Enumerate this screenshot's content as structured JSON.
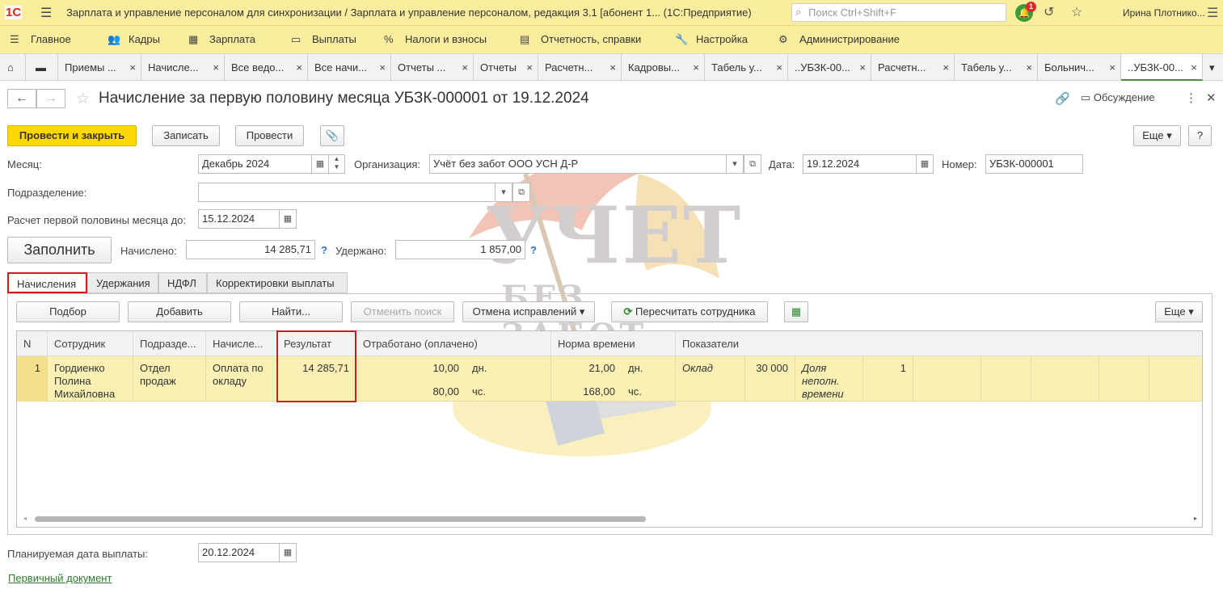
{
  "titlebar": {
    "logo": "1С",
    "title": "Зарплата и управление персоналом для синхронизации / Зарплата и управление персоналом, редакция 3.1 [абонент 1...   (1С:Предприятие)",
    "search_placeholder": "Поиск Ctrl+Shift+F",
    "notification_count": "1",
    "user": "Ирина Плотнико..."
  },
  "menu": [
    {
      "label": "Главное",
      "icon": "menu-icon"
    },
    {
      "label": "Кадры",
      "icon": "people-icon"
    },
    {
      "label": "Зарплата",
      "icon": "calculator-icon"
    },
    {
      "label": "Выплаты",
      "icon": "wallet-icon"
    },
    {
      "label": "Налоги и взносы",
      "icon": "percent-icon"
    },
    {
      "label": "Отчетность, справки",
      "icon": "report-icon"
    },
    {
      "label": "Настройка",
      "icon": "wrench-icon"
    },
    {
      "label": "Администрирование",
      "icon": "gear-icon"
    }
  ],
  "open_tabs": [
    "Приемы ...",
    "Начисле...",
    "Все ведо...",
    "Все начи...",
    "Отчеты ...",
    "Отчеты",
    "Расчетн...",
    "Кадровы...",
    "Табель у...",
    "..УБЗК-00...",
    "Расчетн...",
    "Табель у...",
    "Больнич...",
    "..УБЗК-00..."
  ],
  "doc": {
    "title": "Начисление за первую половину месяца УБЗК-000001 от 19.12.2024",
    "discussion": "Обсуждение"
  },
  "toolbar": {
    "post_close": "Провести и закрыть",
    "save": "Записать",
    "post": "Провести",
    "more": "Еще",
    "help": "?"
  },
  "form": {
    "month_label": "Месяц:",
    "month_value": "Декабрь 2024",
    "org_label": "Организация:",
    "org_value": "Учёт без забот ООО УСН Д-Р",
    "date_label": "Дата:",
    "date_value": "19.12.2024",
    "number_label": "Номер:",
    "number_value": "УБЗК-000001",
    "division_label": "Подразделение:",
    "division_value": "",
    "calc_until_label": "Расчет первой половины месяца до:",
    "calc_until_value": "15.12.2024",
    "fill_button": "Заполнить",
    "accrued_label": "Начислено:",
    "accrued_value": "14 285,71",
    "withheld_label": "Удержано:",
    "withheld_value": "1 857,00",
    "help_mark": "?"
  },
  "inner_tabs": [
    "Начисления",
    "Удержания",
    "НДФЛ",
    "Корректировки выплаты"
  ],
  "table_toolbar": {
    "select": "Подбор",
    "add": "Добавить",
    "find": "Найти...",
    "cancel_search": "Отменить поиск",
    "cancel_fixes": "Отмена исправлений",
    "recalc": "Пересчитать сотрудника",
    "more": "Еще"
  },
  "table": {
    "columns": [
      "N",
      "Сотрудник",
      "Подразде...",
      "Начисле...",
      "Результат",
      "Отработано (оплачено)",
      "Норма времени",
      "Показатели"
    ],
    "rows": [
      {
        "n": "1",
        "employee": "Гордиенко Полина Михайловна",
        "division": "Отдел продаж",
        "accrual": "Оплата по окладу",
        "result": "14 285,71",
        "worked_days": "10,00",
        "worked_days_unit": "дн.",
        "worked_hours": "80,00",
        "worked_hours_unit": "чс.",
        "norm_days": "21,00",
        "norm_days_unit": "дн.",
        "norm_hours": "168,00",
        "norm_hours_unit": "чс.",
        "indicator1_name": "Оклад",
        "indicator1_value": "30 000",
        "indicator2_name": "Доля неполн. времени",
        "indicator2_value": "1"
      }
    ]
  },
  "footer": {
    "pay_date_label": "Планируемая дата выплаты:",
    "pay_date_value": "20.12.2024",
    "primary_doc_link": "Первичный документ"
  },
  "watermark": {
    "line1": "УЧЕТ",
    "line2": "БЕЗ ЗАБОТ"
  }
}
